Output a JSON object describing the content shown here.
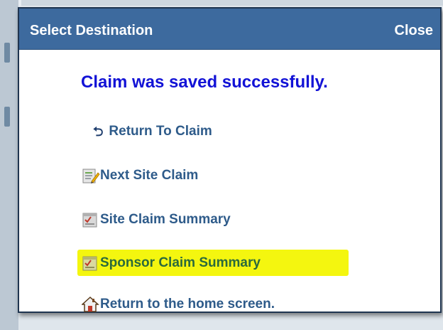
{
  "dialog": {
    "title": "Select Destination",
    "close_label": "Close",
    "message": "Claim was saved successfully.",
    "options": [
      {
        "label": "Return To Claim",
        "icon": "return-arrow-icon"
      },
      {
        "label": "Next Site Claim",
        "icon": "edit-document-icon"
      },
      {
        "label": "Site Claim Summary",
        "icon": "checklist-icon"
      },
      {
        "label": "Sponsor Claim Summary",
        "icon": "checklist-icon",
        "highlighted": true
      },
      {
        "label": "Return to the home screen.",
        "icon": "home-icon"
      }
    ]
  },
  "colors": {
    "titlebar": "#3d6a9e",
    "message": "#1212d6",
    "link": "#2e5b8a",
    "highlight": "#f4f60f"
  }
}
